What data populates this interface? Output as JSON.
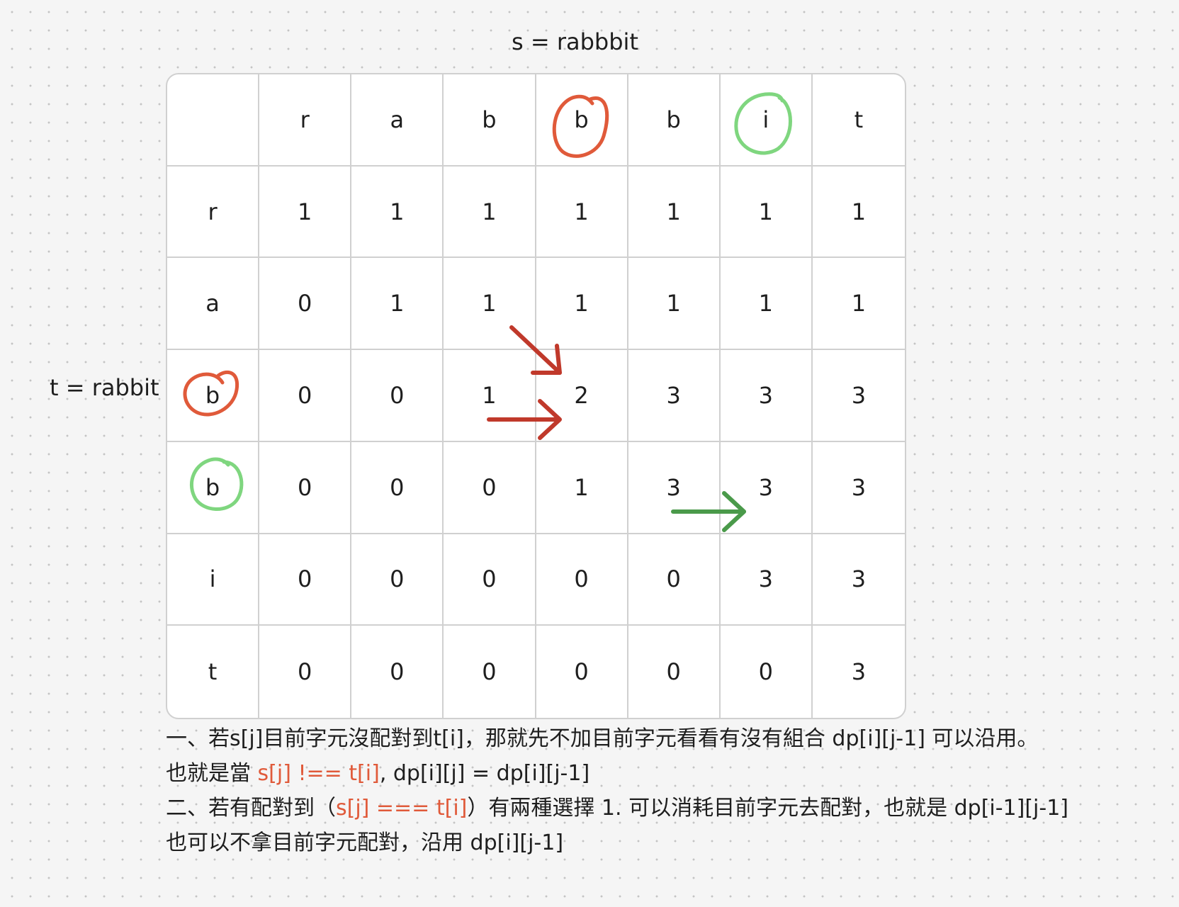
{
  "labels": {
    "s_label": "s = rabbbit",
    "t_label": "t = rabbit"
  },
  "table": {
    "header": [
      "",
      "r",
      "a",
      "b",
      "b",
      "b",
      "i",
      "t"
    ],
    "rows": [
      [
        "r",
        "1",
        "1",
        "1",
        "1",
        "1",
        "1",
        "1"
      ],
      [
        "a",
        "0",
        "1",
        "1",
        "1",
        "1",
        "1",
        "1"
      ],
      [
        "b",
        "0",
        "0",
        "1",
        "2",
        "3",
        "3",
        "3"
      ],
      [
        "b",
        "0",
        "0",
        "0",
        "1",
        "3",
        "3",
        "3"
      ],
      [
        "i",
        "0",
        "0",
        "0",
        "0",
        "0",
        "3",
        "3"
      ],
      [
        "t",
        "0",
        "0",
        "0",
        "0",
        "0",
        "0",
        "3"
      ]
    ]
  },
  "colors": {
    "circle_red": "#e05a3a",
    "circle_green": "#7fd67f",
    "arrow_red": "#c0392b",
    "arrow_green": "#4a9a4a",
    "text_highlight": "#e05a3a"
  },
  "notes": {
    "line1": "一、若s[j]目前字元沒配對到t[i]，那就先不加目前字元看看有沒有組合 dp[i][j-1] 可以沿用。",
    "line2_a": "也就是當 ",
    "line2_hl": "s[j] !== t[i]",
    "line2_b": ", dp[i][j] = dp[i][j-1]",
    "line3_a": "二、若有配對到（",
    "line3_hl": "s[j] === t[i]",
    "line3_b": "）有兩種選擇 1. 可以消耗目前字元去配對，也就是 dp[i-1][j-1]",
    "line4": "也可以不拿目前字元配對，沿用 dp[i][j-1]"
  }
}
